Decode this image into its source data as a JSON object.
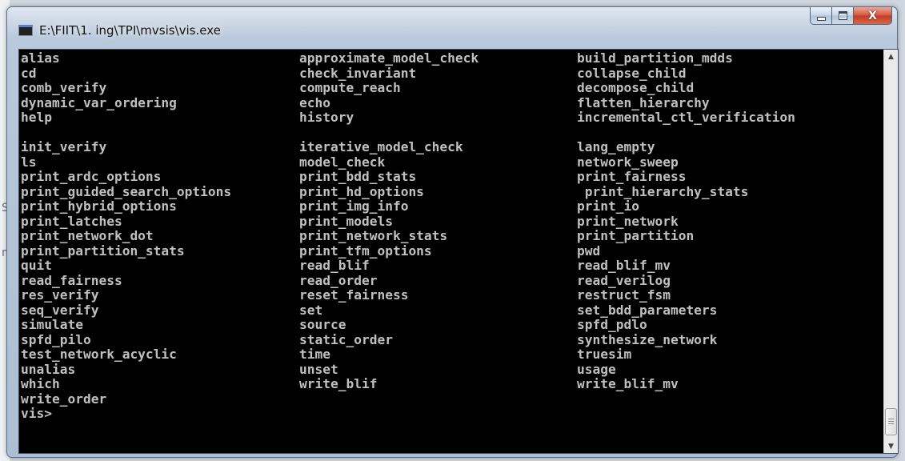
{
  "window": {
    "title": "E:\\FIIT\\1. ing\\TPI\\mvsis\\vis.exe",
    "icon": "console-app-icon"
  },
  "caption_buttons": {
    "minimize_icon": "minimize-icon",
    "maximize_icon": "maximize-icon",
    "close_icon": "close-icon",
    "close_glyph": "X"
  },
  "background_fragments": [
    "S",
    "n"
  ],
  "console": {
    "rows": [
      [
        "alias",
        "approximate_model_check",
        "build_partition_mdds"
      ],
      [
        "cd",
        "check_invariant",
        "collapse_child"
      ],
      [
        "comb_verify",
        "compute_reach",
        "decompose_child"
      ],
      [
        "dynamic_var_ordering",
        "echo",
        "flatten_hierarchy"
      ],
      [
        "help",
        "history",
        "incremental_ctl_verification"
      ],
      [
        "",
        "",
        ""
      ],
      [
        "init_verify",
        "iterative_model_check",
        "lang_empty"
      ],
      [
        "ls",
        "model_check",
        "network_sweep"
      ],
      [
        "print_ardc_options",
        "print_bdd_stats",
        "print_fairness"
      ],
      [
        "print_guided_search_options",
        "print_hd_options",
        " print_hierarchy_stats"
      ],
      [
        "print_hybrid_options",
        "print_img_info",
        "print_io"
      ],
      [
        "print_latches",
        "print_models",
        "print_network"
      ],
      [
        "print_network_dot",
        "print_network_stats",
        "print_partition"
      ],
      [
        "print_partition_stats",
        "print_tfm_options",
        "pwd"
      ],
      [
        "quit",
        "read_blif",
        "read_blif_mv"
      ],
      [
        "read_fairness",
        "read_order",
        "read_verilog"
      ],
      [
        "res_verify",
        "reset_fairness",
        "restruct_fsm"
      ],
      [
        "seq_verify",
        "set",
        "set_bdd_parameters"
      ],
      [
        "simulate",
        "source",
        "spfd_pdlo"
      ],
      [
        "spfd_pilo",
        "static_order",
        "synthesize_network"
      ],
      [
        "test_network_acyclic",
        "time",
        "truesim"
      ],
      [
        "unalias",
        "unset",
        "usage"
      ],
      [
        "which",
        "write_blif",
        "write_blif_mv"
      ],
      [
        "write_order",
        "",
        ""
      ]
    ],
    "prompt": "vis>"
  },
  "colors": {
    "console_background": "#000000",
    "console_text": "#c0c0c0",
    "close_button": "#c33a22"
  }
}
